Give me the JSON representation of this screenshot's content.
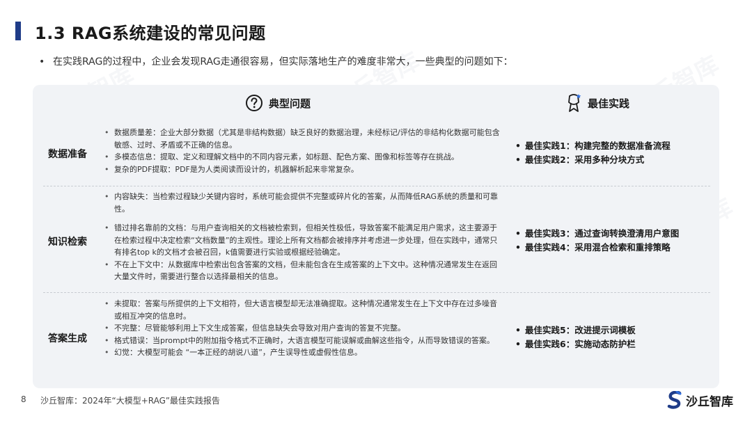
{
  "slide": {
    "title": "1.3 RAG系统建设的常见问题",
    "intro": "在实践RAG的过程中，企业会发现RAG走通很容易，但实际落地生产的难度非常大，一些典型的问题如下："
  },
  "table": {
    "header_problem": "典型问题",
    "header_best": "最佳实践",
    "rows": [
      {
        "label": "数据准备",
        "issues": [
          "数据质量差：企业大部分数据（尤其是非结构数据）缺乏良好的数据治理，未经标记/评估的非结构化数据可能包含敏感、过时、矛盾或不正确的信息。",
          "多模态信息：提取、定义和理解文档中的不同内容元素，如标题、配色方案、图像和标签等存在挑战。",
          "复杂的PDF提取：PDF是为人类阅读而设计的，机器解析起来非常复杂。"
        ],
        "best": [
          "最佳实践1：构建完整的数据准备流程",
          "最佳实践2：采用多种分块方式"
        ]
      },
      {
        "label": "知识检索",
        "issues": [
          "内容缺失：当检索过程缺少关键内容时，系统可能会提供不完整或碎片化的答案，从而降低RAG系统的质量和可靠性。",
          "错过排名靠前的文档：与用户查询相关的文档被检索到，但相关性极低，导致答案不能满足用户需求，这主要源于在检索过程中决定检索“文档数量”的主观性。理论上所有文档都会被排序并考虑进一步处理，但在实践中，通常只有排名top k的文档才会被召回，k值需要进行实验或根据经验确定。",
          "不在上下文中：从数据库中检索出包含答案的文档，但未能包含在生成答案的上下文中。这种情况通常发生在返回大量文件时，需要进行整合以选择最相关的信息。"
        ],
        "best": [
          "最佳实践3：通过查询转换澄清用户意图",
          "最佳实践4：采用混合检索和重排策略"
        ]
      },
      {
        "label": "答案生成",
        "issues": [
          "未提取：答案与所提供的上下文相符，但大语言模型却无法准确提取。这种情况通常发生在上下文中存在过多噪音或相互冲突的信息时。",
          "不完整：尽管能够利用上下文生成答案，但信息缺失会导致对用户查询的答复不完整。",
          "格式错误：当prompt中的附加指令格式不正确时，大语言模型可能误解或曲解这些指令，从而导致错误的答案。",
          "幻觉：大模型可能会 “一本正经的胡说八道”，产生误导性或虚假性信息。"
        ],
        "best": [
          "最佳实践5：改进提示词模板",
          "最佳实践6：实施动态防护栏"
        ]
      }
    ]
  },
  "footer": {
    "page": "8",
    "text": "沙丘智库：2024年“大模型+RAG”最佳实践报告",
    "logo": "沙丘智库"
  },
  "watermark": "沙丘智库",
  "colors": {
    "accent": "#1f3c88",
    "panel": "#f1f3f6"
  },
  "icons": {
    "problem": "question-circle-icon",
    "best": "award-ribbon-icon",
    "logo": "shaqiu-s-logo-icon"
  }
}
